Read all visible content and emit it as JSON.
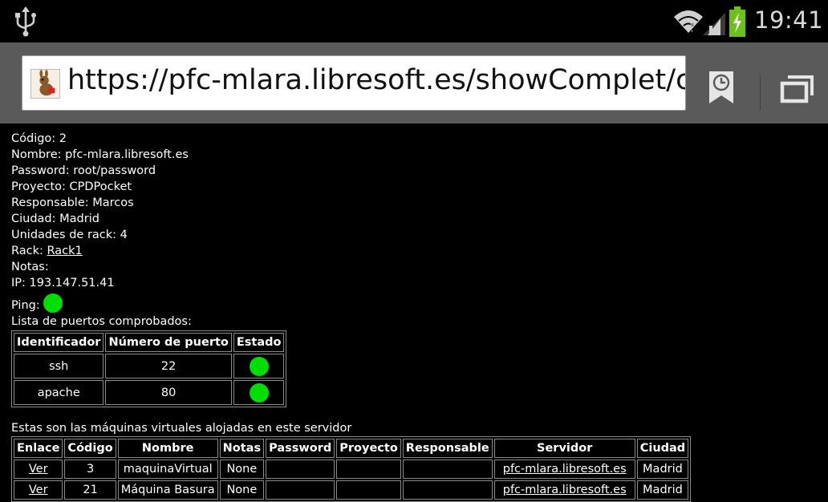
{
  "status_bar": {
    "time": "19:41",
    "icons": [
      "usb-icon",
      "wifi-icon",
      "signal-icon",
      "battery-charging-icon"
    ]
  },
  "browser": {
    "url": "https://pfc-mlara.libresoft.es/showComplet/co",
    "icons": [
      "favicon",
      "bookmarks-icon",
      "tabs-icon"
    ]
  },
  "details": {
    "codigo": "Código: 2",
    "nombre": "Nombre: pfc-mlara.libresoft.es",
    "password": "Password: root/password",
    "proyecto": "Proyecto: CPDPocket",
    "responsable": "Responsable: Marcos",
    "ciudad": "Ciudad: Madrid",
    "unidades": "Unidades de rack: 4",
    "rack_label": "Rack: ",
    "rack_link": "Rack1",
    "notas": "Notas:",
    "ip": "IP: 193.147.51.41",
    "ping_label": "Ping:",
    "ping_color": "#00dd00"
  },
  "ports": {
    "caption": "Lista de puertos comprobados:",
    "headers": [
      "Identificador",
      "Número de puerto",
      "Estado"
    ],
    "rows": [
      {
        "id": "ssh",
        "port": "22",
        "state": "ok"
      },
      {
        "id": "apache",
        "port": "80",
        "state": "ok"
      }
    ]
  },
  "vms": {
    "caption": "Estas son las máquinas virtuales alojadas en este servidor",
    "headers": [
      "Enlace",
      "Código",
      "Nombre",
      "Notas",
      "Password",
      "Proyecto",
      "Responsable",
      "Servidor",
      "Ciudad"
    ],
    "rows": [
      {
        "enlace": "Ver",
        "codigo": "3",
        "nombre": "maquinaVirtual",
        "notas": "None",
        "password": "",
        "proyecto": "",
        "responsable": "",
        "servidor": "pfc-mlara.libresoft.es",
        "ciudad": "Madrid"
      },
      {
        "enlace": "Ver",
        "codigo": "21",
        "nombre": "Máquina Basura",
        "notas": "None",
        "password": "",
        "proyecto": "",
        "responsable": "",
        "servidor": "pfc-mlara.libresoft.es",
        "ciudad": "Madrid"
      }
    ]
  }
}
